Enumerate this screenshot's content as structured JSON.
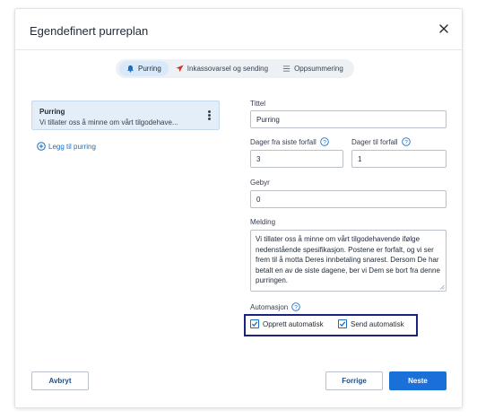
{
  "dialog": {
    "title": "Egendefinert purreplan",
    "close_icon": "close-icon"
  },
  "steps": [
    {
      "label": "Purring",
      "icon": "bell-icon",
      "active": true
    },
    {
      "label": "Inkassovarsel og sending",
      "icon": "send-icon",
      "active": false
    },
    {
      "label": "Oppsummering",
      "icon": "list-icon",
      "active": false
    }
  ],
  "reminder_card": {
    "title": "Purring",
    "text": "Vi tillater oss å minne om vårt tilgodehave..."
  },
  "add_reminder": "Legg til purring",
  "form": {
    "title_label": "Tittel",
    "title_value": "Purring",
    "days_last_due_label": "Dager fra siste forfall",
    "days_last_due_value": "3",
    "days_to_due_label": "Dager til forfall",
    "days_to_due_value": "1",
    "fee_label": "Gebyr",
    "fee_value": "0",
    "message_label": "Melding",
    "message_value": "Vi tillater oss å minne om vårt tilgodehavende ifølge nedenstående spesifikasjon. Postene er forfalt, og vi ser frem til å motta Deres innbetaling snarest. Dersom De har betalt en av de siste dagene, ber vi Dem se bort fra denne purringen.",
    "automation_label": "Automasjon",
    "create_auto_label": "Opprett automatisk",
    "create_auto_checked": true,
    "send_auto_label": "Send automatisk",
    "send_auto_checked": true
  },
  "footer": {
    "cancel": "Avbryt",
    "previous": "Forrige",
    "next": "Neste"
  },
  "colors": {
    "primary": "#1a6fd8",
    "link": "#1a6fc2",
    "highlight_border": "#1a237e",
    "active_step": "#d9e9f9",
    "card_bg": "#e3eef8"
  }
}
